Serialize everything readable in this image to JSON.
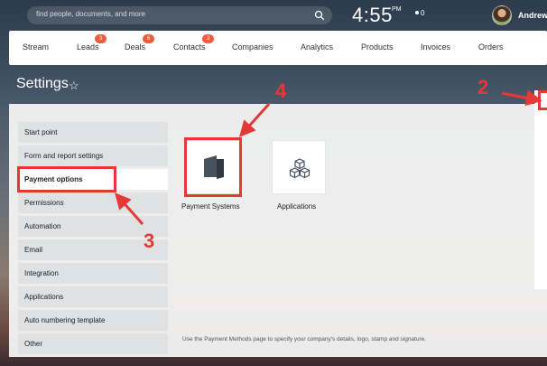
{
  "header": {
    "search_placeholder": "find people, documents, and more",
    "clock": "4:55",
    "ampm": "PM",
    "notifications": "0",
    "user_name": "Andrew"
  },
  "nav": {
    "items": [
      {
        "label": "Stream",
        "badge": ""
      },
      {
        "label": "Leads",
        "badge": "3"
      },
      {
        "label": "Deals",
        "badge": "6"
      },
      {
        "label": "Contacts",
        "badge": "3"
      },
      {
        "label": "Companies",
        "badge": ""
      },
      {
        "label": "Analytics",
        "badge": ""
      },
      {
        "label": "Products",
        "badge": ""
      },
      {
        "label": "Invoices",
        "badge": ""
      },
      {
        "label": "Orders",
        "badge": ""
      }
    ]
  },
  "page": {
    "title": "Settings",
    "star": "☆"
  },
  "menu": {
    "items": [
      "Start point",
      "Form and report settings",
      "Payment options",
      "Permissions",
      "Automation",
      "Email",
      "Integration",
      "Applications",
      "Auto numbering template",
      "Other"
    ],
    "active_index": 2
  },
  "tiles": [
    {
      "label": "Payment Systems",
      "icon": "wallet-icon"
    },
    {
      "label": "Applications",
      "icon": "cubes-icon"
    }
  ],
  "footnote": "Use the Payment Methods page to specify your company's details, logo, stamp and signature.",
  "annotations": {
    "numbers": [
      "2",
      "3",
      "4"
    ],
    "color": "#e53935"
  },
  "colors": {
    "badge": "#f25a3e",
    "menu_bg": "#dfe1e3",
    "panel_bg": "#f3f3f3"
  }
}
